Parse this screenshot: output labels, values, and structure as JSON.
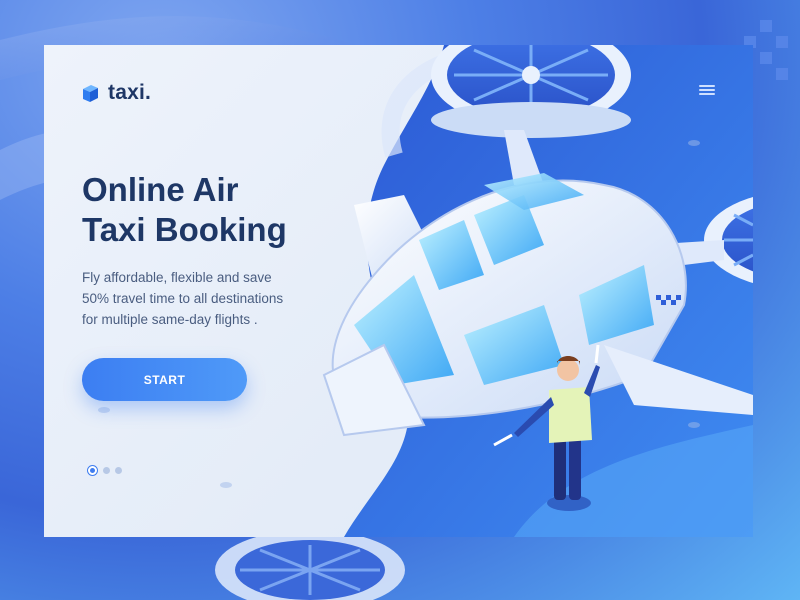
{
  "brand": {
    "name": "taxi.",
    "logo_icon": "cube-logo-icon"
  },
  "header": {
    "menu_icon": "hamburger-menu-icon"
  },
  "hero": {
    "headline_line1": "Online Air",
    "headline_line2": "Taxi Booking",
    "description_line1": "Fly affordable, flexible and save",
    "description_line2": "50% travel time to all destinations",
    "description_line3": "for multiple same-day flights ."
  },
  "cta": {
    "label": "START"
  },
  "carousel": {
    "slide_count": 3,
    "active_index": 0
  },
  "colors": {
    "primary": "#3f7df0",
    "headline": "#1e3766",
    "text": "#4a5d80",
    "right_panel": "#2f5fd8",
    "card_bg": "#eef3fb"
  }
}
